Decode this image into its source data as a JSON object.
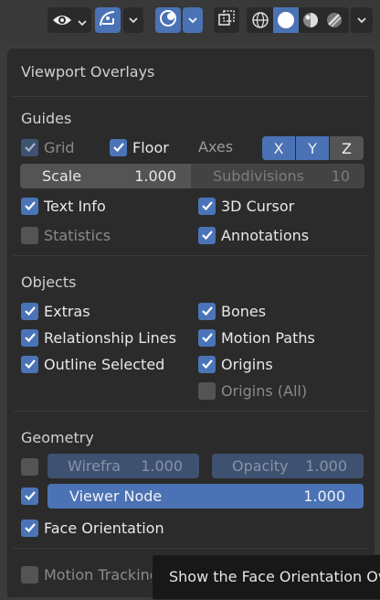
{
  "header_tools": [
    {
      "icon": "visibility-eye-icon"
    },
    {
      "icon": "gizmo-icon"
    },
    {
      "icon": "overlays-icon"
    },
    {
      "icon": "xray-icon"
    },
    {
      "icon": "shading-wireframe-icon"
    },
    {
      "icon": "shading-solid-icon"
    },
    {
      "icon": "shading-material-icon"
    },
    {
      "icon": "shading-rendered-icon"
    }
  ],
  "panel": {
    "title": "Viewport Overlays",
    "guides": {
      "heading": "Guides",
      "grid": {
        "label": "Grid",
        "checked": true
      },
      "floor": {
        "label": "Floor",
        "checked": true
      },
      "axes_label": "Axes",
      "axes": [
        {
          "label": "X",
          "enabled": true
        },
        {
          "label": "Y",
          "enabled": true
        },
        {
          "label": "Z",
          "enabled": false
        }
      ],
      "scale": {
        "label": "Scale",
        "value": "1.000"
      },
      "subdivisions": {
        "label": "Subdivisions",
        "value": "10"
      },
      "text_info": {
        "label": "Text Info",
        "checked": true
      },
      "cursor_3d": {
        "label": "3D Cursor",
        "checked": true
      },
      "statistics": {
        "label": "Statistics",
        "checked": false
      },
      "annotations": {
        "label": "Annotations",
        "checked": true
      }
    },
    "objects": {
      "heading": "Objects",
      "extras": {
        "label": "Extras",
        "checked": true
      },
      "bones": {
        "label": "Bones",
        "checked": true
      },
      "relationship_lines": {
        "label": "Relationship Lines",
        "checked": true
      },
      "motion_paths": {
        "label": "Motion Paths",
        "checked": true
      },
      "outline_selected": {
        "label": "Outline Selected",
        "checked": true
      },
      "origins": {
        "label": "Origins",
        "checked": true
      },
      "origins_all": {
        "label": "Origins (All)",
        "checked": false
      }
    },
    "geometry": {
      "heading": "Geometry",
      "wireframe": {
        "label": "Wirefra",
        "value": "1.000",
        "checked": false
      },
      "opacity": {
        "label": "Opacity",
        "value": "1.000"
      },
      "viewer_node": {
        "label": "Viewer Node",
        "value": "1.000",
        "checked": true
      },
      "face_orientation": {
        "label": "Face Orientation",
        "checked": true
      }
    },
    "motion_tracking": {
      "label": "Motion Tracking",
      "checked": false
    }
  },
  "tooltip": "Show the Face Orientation Ov",
  "colors": {
    "accent": "#4a72b5",
    "panel_bg": "#2b2b2b",
    "header_bg": "#393939"
  }
}
